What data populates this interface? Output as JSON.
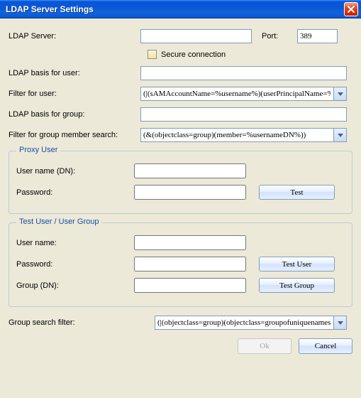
{
  "window": {
    "title": "LDAP Server Settings"
  },
  "main": {
    "ldap_server_label": "LDAP Server:",
    "ldap_server_value": "",
    "port_label": "Port:",
    "port_value": "389",
    "secure_conn_label": "Secure connection",
    "secure_conn_checked": false,
    "ldap_basis_user_label": "LDAP basis for user:",
    "ldap_basis_user_value": "",
    "filter_user_label": "Filter for user:",
    "filter_user_value": "(|(sAMAccountName=%username%)(userPrincipalName=%",
    "ldap_basis_group_label": "LDAP basis for group:",
    "ldap_basis_group_value": "",
    "filter_group_member_label": "Filter for group member search:",
    "filter_group_member_value": "(&(objectclass=group)(member=%usernameDN%))",
    "group_search_filter_label": "Group search filter:",
    "group_search_filter_value": "(|(objectclass=group)(objectclass=groupofuniquenames))"
  },
  "proxy": {
    "legend": "Proxy User",
    "username_label": "User name (DN):",
    "username_value": "",
    "password_label": "Password:",
    "password_value": "",
    "test_btn": "Test"
  },
  "testuser": {
    "legend": "Test User / User Group",
    "username_label": "User name:",
    "username_value": "",
    "password_label": "Password:",
    "password_value": "",
    "group_label": "Group (DN):",
    "group_value": "",
    "test_user_btn": "Test User",
    "test_group_btn": "Test Group"
  },
  "buttons": {
    "ok": "Ok",
    "cancel": "Cancel"
  }
}
